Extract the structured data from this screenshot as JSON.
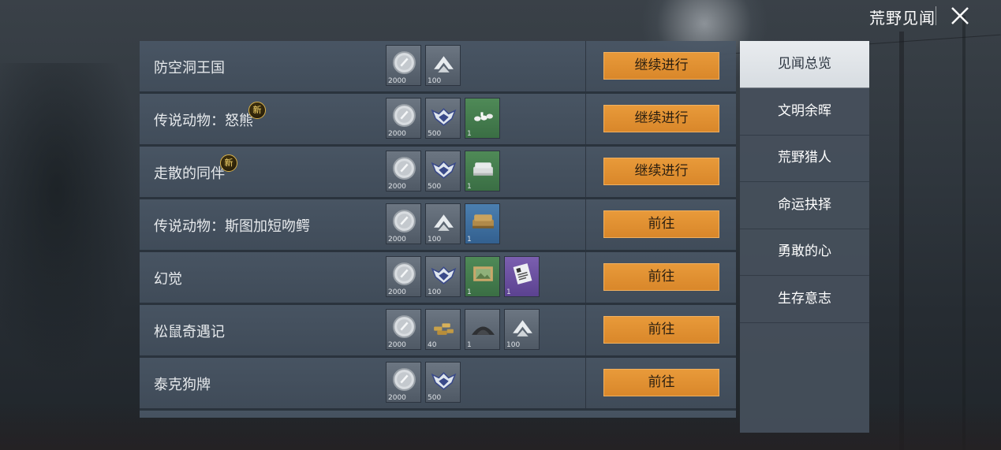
{
  "header": {
    "title": "荒野见闻"
  },
  "rows": [
    {
      "name": "防空洞王国",
      "is_new": false,
      "action": "继续进行",
      "rewards": [
        {
          "icon": "silver-coin",
          "qty": "2000",
          "color": "gray"
        },
        {
          "icon": "rank-chevron",
          "qty": "100",
          "color": "gray"
        }
      ]
    },
    {
      "name": "传说动物：怒熊",
      "is_new": true,
      "action": "继续进行",
      "rewards": [
        {
          "icon": "silver-coin",
          "qty": "2000",
          "color": "gray"
        },
        {
          "icon": "eagle-emblem",
          "qty": "500",
          "color": "gray"
        },
        {
          "icon": "white-items",
          "qty": "1",
          "color": "green"
        }
      ]
    },
    {
      "name": "走散的同伴",
      "is_new": true,
      "action": "继续进行",
      "rewards": [
        {
          "icon": "silver-coin",
          "qty": "2000",
          "color": "gray"
        },
        {
          "icon": "eagle-emblem",
          "qty": "500",
          "color": "gray"
        },
        {
          "icon": "gray-sofa",
          "qty": "1",
          "color": "green"
        }
      ]
    },
    {
      "name": "传说动物：斯图加短吻鳄",
      "is_new": false,
      "action": "前往",
      "rewards": [
        {
          "icon": "silver-coin",
          "qty": "2000",
          "color": "gray"
        },
        {
          "icon": "rank-chevron",
          "qty": "100",
          "color": "gray"
        },
        {
          "icon": "leather-sofa",
          "qty": "1",
          "color": "blue"
        }
      ]
    },
    {
      "name": "幻觉",
      "is_new": false,
      "action": "前往",
      "rewards": [
        {
          "icon": "silver-coin",
          "qty": "2000",
          "color": "gray"
        },
        {
          "icon": "eagle-emblem",
          "qty": "100",
          "color": "gray"
        },
        {
          "icon": "picture-frame",
          "qty": "1",
          "color": "green"
        },
        {
          "icon": "card-item",
          "qty": "1",
          "color": "purple"
        }
      ]
    },
    {
      "name": "松鼠奇遇记",
      "is_new": false,
      "action": "前往",
      "rewards": [
        {
          "icon": "silver-coin",
          "qty": "2000",
          "color": "gray"
        },
        {
          "icon": "ammo-pile",
          "qty": "40",
          "color": "gray"
        },
        {
          "icon": "powder-pile",
          "qty": "1",
          "color": "gray"
        },
        {
          "icon": "rank-chevron",
          "qty": "100",
          "color": "gray"
        }
      ]
    },
    {
      "name": "泰克狗牌",
      "is_new": false,
      "action": "前往",
      "rewards": [
        {
          "icon": "silver-coin",
          "qty": "2000",
          "color": "gray"
        },
        {
          "icon": "eagle-emblem",
          "qty": "500",
          "color": "gray"
        }
      ]
    }
  ],
  "new_badge_label": "新",
  "side_menu": [
    {
      "label": "见闻总览",
      "active": true
    },
    {
      "label": "文明余晖",
      "active": false
    },
    {
      "label": "荒野猎人",
      "active": false
    },
    {
      "label": "命运抉择",
      "active": false
    },
    {
      "label": "勇敢的心",
      "active": false
    },
    {
      "label": "生存意志",
      "active": false
    }
  ],
  "colors": {
    "accent_button": "#e08f33",
    "panel": "#4a5766",
    "new_badge": "#d9b24a"
  }
}
